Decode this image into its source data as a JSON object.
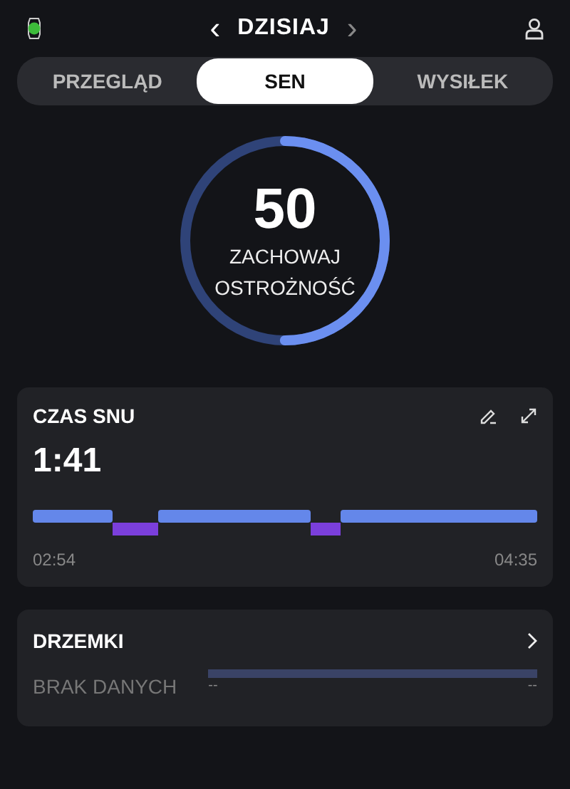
{
  "header": {
    "prev": "‹",
    "date": "DZISIAJ",
    "next": "›"
  },
  "tabs": [
    {
      "label": "PRZEGLĄD",
      "selected": false
    },
    {
      "label": "SEN",
      "selected": true
    },
    {
      "label": "WYSIŁEK",
      "selected": false
    }
  ],
  "score": {
    "value": "50",
    "status_line_1": "ZACHOWAJ",
    "status_line_2": "OSTROŻNOŚĆ",
    "level": 0.5
  },
  "sleep_time": {
    "title": "CZAS SNU",
    "duration": "1:41",
    "start": "02:54",
    "end": "04:35"
  },
  "naps": {
    "title": "DRZEMKI",
    "empty_text": "BRAK DANYCH",
    "start": "--",
    "end": "--"
  }
}
